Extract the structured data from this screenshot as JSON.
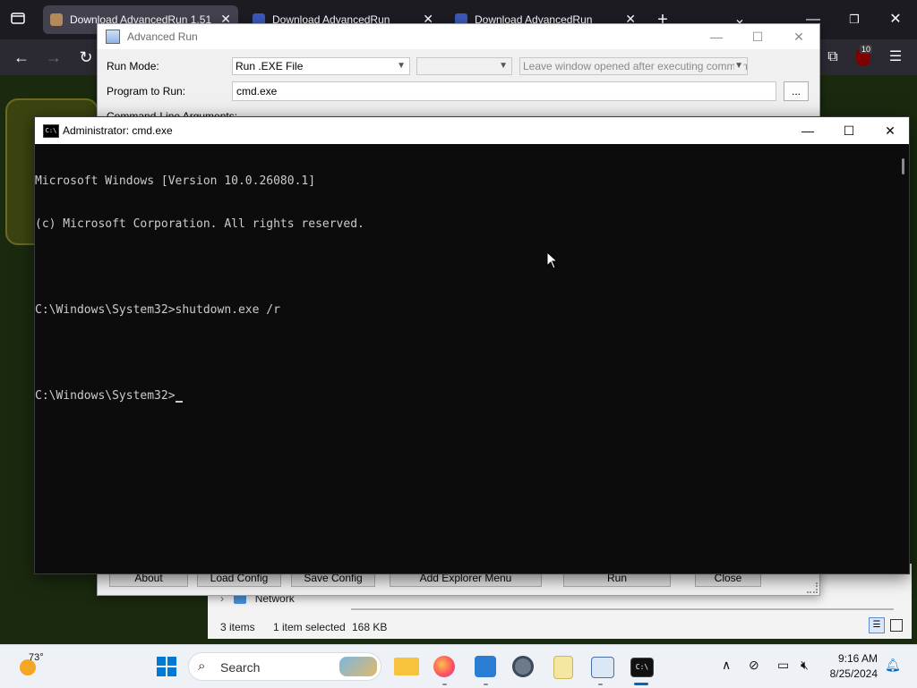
{
  "browser": {
    "tabs": [
      {
        "label": "Download AdvancedRun 1.51",
        "active": true
      },
      {
        "label": "Download AdvancedRun",
        "active": false
      },
      {
        "label": "Download AdvancedRun",
        "active": false
      }
    ],
    "new_tab_symbol": "+",
    "badge_count": "10"
  },
  "advanced_run": {
    "title": "Advanced Run",
    "run_mode_label": "Run Mode:",
    "run_mode_value": "Run .EXE File",
    "leave_window_option": "Leave window opened after executing command",
    "program_label": "Program to Run:",
    "program_value": "cmd.exe",
    "browse_label": "...",
    "cmdline_label": "Command-Line Arguments:",
    "buttons": {
      "about": "About",
      "load_config": "Load Config",
      "save_config": "Save Config",
      "add_explorer_menu": "Add Explorer Menu",
      "run": "Run",
      "close": "Close"
    }
  },
  "explorer": {
    "network_label": "Network",
    "status_items": "3 items",
    "status_selected": "1 item selected",
    "status_size": "168 KB"
  },
  "cmd": {
    "title": "Administrator: cmd.exe",
    "lines": [
      "Microsoft Windows [Version 10.0.26080.1]",
      "(c) Microsoft Corporation. All rights reserved.",
      "",
      "C:\\Windows\\System32>shutdown.exe /r",
      "",
      "C:\\Windows\\System32>"
    ]
  },
  "taskbar": {
    "weather_temp": "73°",
    "search_placeholder": "Search",
    "time": "9:16 AM",
    "date": "8/25/2024",
    "icons": [
      "windows-start-icon",
      "file-explorer-icon",
      "firefox-icon",
      "puzzle-app-icon",
      "settings-gear-icon",
      "notepad-icon",
      "advancedrun-icon",
      "terminal-icon"
    ]
  },
  "colors": {
    "cmd_bg": "#0c0c0c",
    "cmd_text": "#cccccc",
    "browser_dark": "#1c1b22",
    "taskbar_bg": "#eef1f6",
    "start_blue": "#0078d4"
  }
}
